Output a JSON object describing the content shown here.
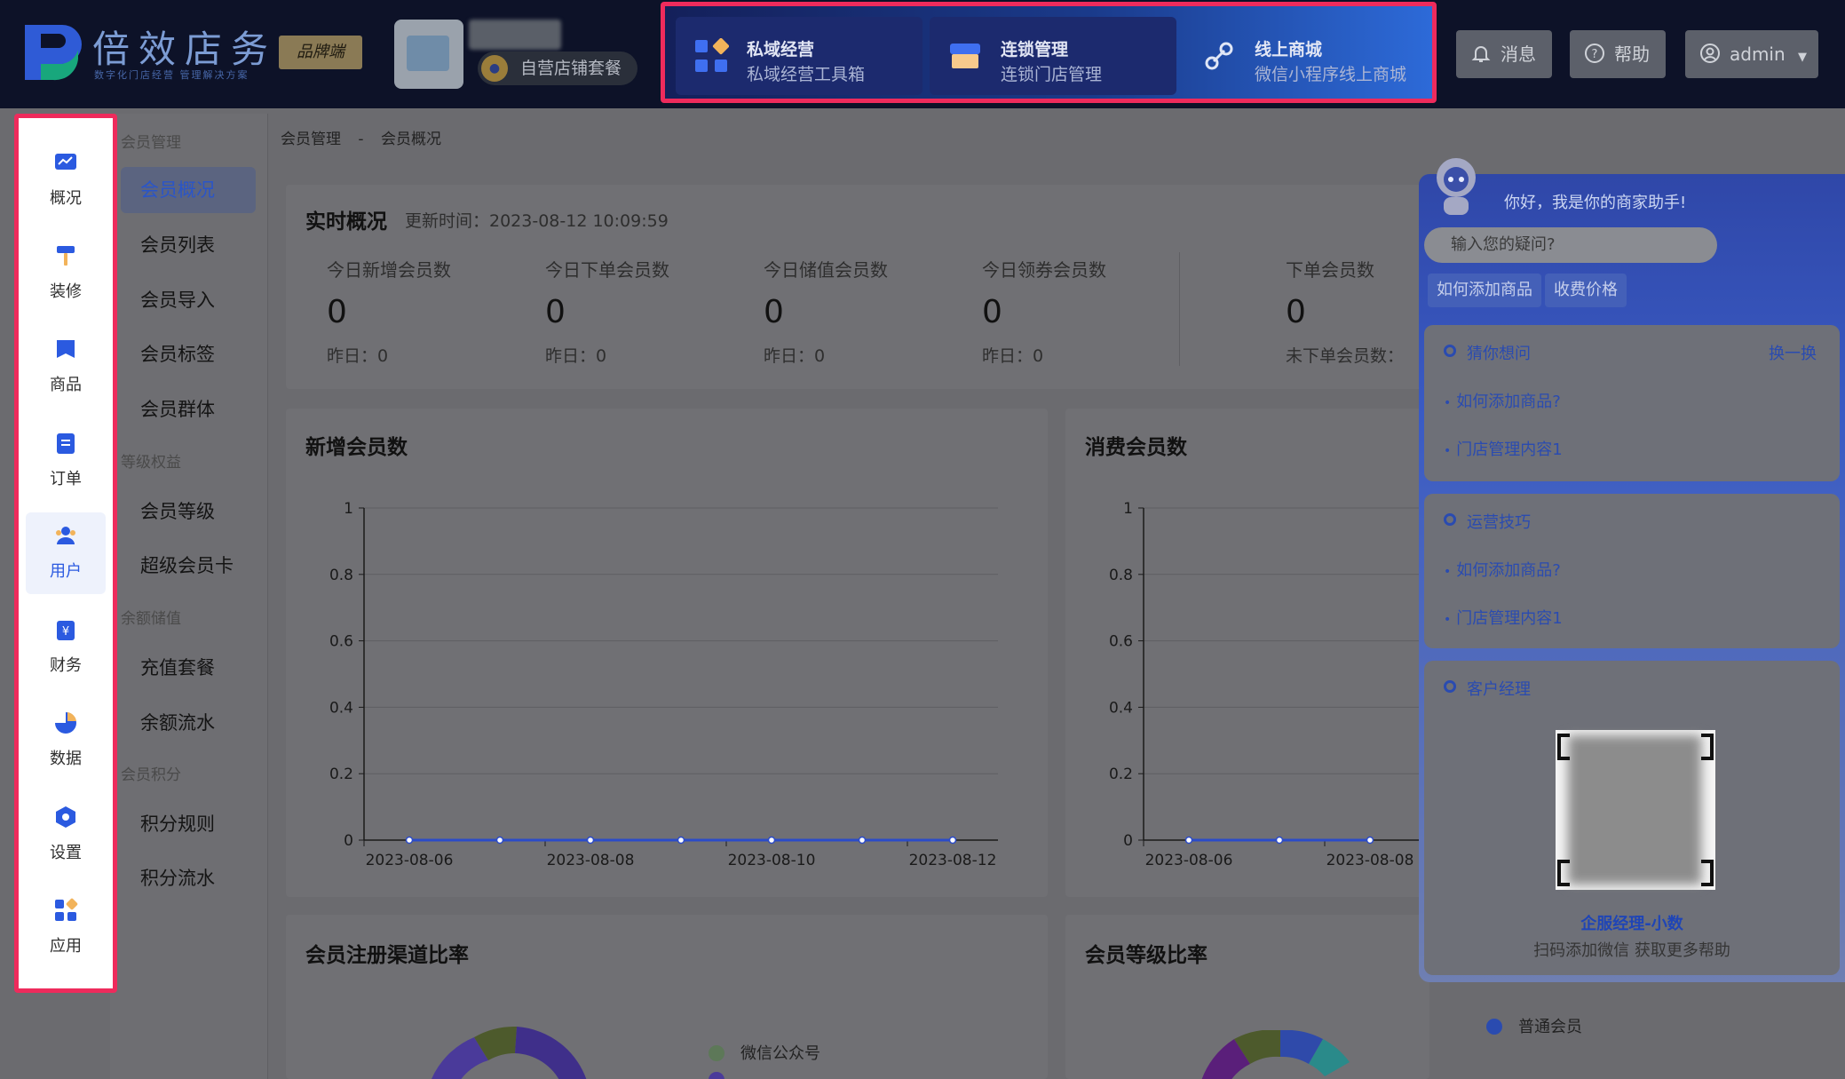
{
  "header": {
    "brand_name": "倍效店务",
    "brand_slogan": "数字化门店经营 管理解决方案",
    "brand_tag": "品牌端",
    "store_package": "自营店铺套餐",
    "features": [
      {
        "title": "私域经营",
        "subtitle": "私域经营工具箱"
      },
      {
        "title": "连锁管理",
        "subtitle": "连锁门店管理"
      },
      {
        "title": "线上商城",
        "subtitle": "微信小程序线上商城"
      }
    ],
    "btn_messages": "消息",
    "btn_help": "帮助",
    "btn_user": "admin"
  },
  "rail": {
    "items": [
      {
        "label": "概况"
      },
      {
        "label": "装修"
      },
      {
        "label": "商品"
      },
      {
        "label": "订单"
      },
      {
        "label": "用户"
      },
      {
        "label": "财务"
      },
      {
        "label": "数据"
      },
      {
        "label": "设置"
      },
      {
        "label": "应用"
      }
    ]
  },
  "submenu": {
    "group1": "会员管理",
    "group1_items": [
      "会员概况",
      "会员列表",
      "会员导入",
      "会员标签",
      "会员群体"
    ],
    "group2": "等级权益",
    "group2_items": [
      "会员等级",
      "超级会员卡"
    ],
    "group3": "余额储值",
    "group3_items": [
      "充值套餐",
      "余额流水"
    ],
    "group4": "会员积分",
    "group4_items": [
      "积分规则",
      "积分流水"
    ]
  },
  "breadcrumb": [
    "会员管理",
    "-",
    "会员概况"
  ],
  "realtime": {
    "title": "实时概况",
    "updated": "更新时间：2023-08-12 10:09:59",
    "stats": [
      {
        "label": "今日新增会员数",
        "value": "0",
        "sub": "昨日：0"
      },
      {
        "label": "今日下单会员数",
        "value": "0",
        "sub": "昨日：0"
      },
      {
        "label": "今日储值会员数",
        "value": "0",
        "sub": "昨日：0"
      },
      {
        "label": "今日领券会员数",
        "value": "0",
        "sub": "昨日：0"
      },
      {
        "label": "下单会员数",
        "value": "0",
        "sub": "未下单会员数："
      }
    ]
  },
  "panels": {
    "new_members": "新增会员数",
    "consume_members": "消费会员数",
    "channel_ratio": "会员注册渠道比率",
    "level_ratio": "会员等级比率"
  },
  "legend": {
    "channel_1": "微信公众号",
    "level_1": "普通会员"
  },
  "colors": {
    "accent": "#2b5ae0",
    "highlight_border": "#ee2b5c",
    "header_bg": "#0d1228"
  },
  "chart_data": [
    {
      "type": "line",
      "title": "新增会员数",
      "x": [
        "2023-08-06",
        "2023-08-07",
        "2023-08-08",
        "2023-08-09",
        "2023-08-10",
        "2023-08-11",
        "2023-08-12"
      ],
      "x_tick_labels": [
        "2023-08-06",
        "2023-08-08",
        "2023-08-10",
        "2023-08-12"
      ],
      "series": [
        {
          "values": [
            0,
            0,
            0,
            0,
            0,
            0,
            0
          ]
        }
      ],
      "ylim": [
        0,
        1
      ],
      "y_ticks": [
        0,
        0.2,
        0.4,
        0.6,
        0.8,
        1
      ],
      "grid": true
    },
    {
      "type": "line",
      "title": "消费会员数",
      "x": [
        "2023-08-06",
        "2023-08-07",
        "2023-08-08"
      ],
      "x_tick_labels": [
        "2023-08-06",
        "2023-08-08"
      ],
      "series": [
        {
          "values": [
            0,
            0,
            0
          ]
        }
      ],
      "ylim": [
        0,
        1
      ],
      "y_ticks": [
        0,
        0.2,
        0.4,
        0.6,
        0.8,
        1
      ],
      "grid": true
    }
  ],
  "assistant": {
    "greeting": "你好，我是你的商家助手!",
    "input_placeholder": "输入您的疑问?",
    "chips": [
      "如何添加商品",
      "收费价格"
    ],
    "guess_title": "猜你想问",
    "guess_swap": "换一换",
    "guess_links": [
      "如何添加商品?",
      "门店管理内容1"
    ],
    "tips_title": "运营技巧",
    "tips_links": [
      "如何添加商品?",
      "门店管理内容1"
    ],
    "manager_title": "客户经理",
    "manager_name": "企服经理-小数",
    "manager_sub": "扫码添加微信 获取更多帮助"
  }
}
